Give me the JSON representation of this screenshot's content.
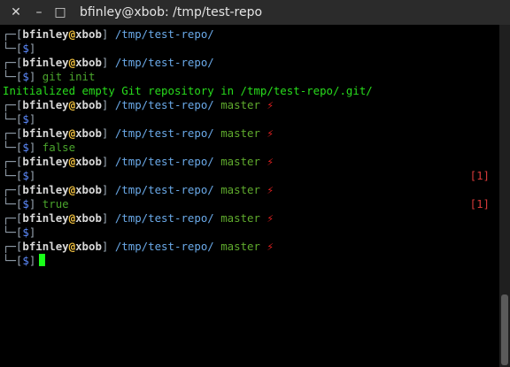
{
  "window": {
    "title": "bfinley@xbob: /tmp/test-repo",
    "close_glyph": "✕",
    "minimize_glyph": "–",
    "maximize_glyph": "□"
  },
  "prompt": {
    "top_frame": "┌─[",
    "user": "bfinley",
    "at": "@",
    "host": "xbob",
    "close_bracket": "]",
    "bottom_frame": "└─[",
    "dollar": "$",
    "bolt": "⚡"
  },
  "terminal": {
    "lines": [
      {
        "kind": "top",
        "path": "/tmp/test-repo/",
        "branch": ""
      },
      {
        "kind": "bottom",
        "cmd": "",
        "exit": ""
      },
      {
        "kind": "top",
        "path": "/tmp/test-repo/",
        "branch": ""
      },
      {
        "kind": "bottom",
        "cmd": "git init",
        "exit": ""
      },
      {
        "kind": "output",
        "text": "Initialized empty Git repository in /tmp/test-repo/.git/"
      },
      {
        "kind": "top",
        "path": "/tmp/test-repo/",
        "branch": "master"
      },
      {
        "kind": "bottom",
        "cmd": "",
        "exit": ""
      },
      {
        "kind": "top",
        "path": "/tmp/test-repo/",
        "branch": "master"
      },
      {
        "kind": "bottom",
        "cmd": "false",
        "exit": ""
      },
      {
        "kind": "top",
        "path": "/tmp/test-repo/",
        "branch": "master"
      },
      {
        "kind": "bottom",
        "cmd": "",
        "exit": "[1]"
      },
      {
        "kind": "top",
        "path": "/tmp/test-repo/",
        "branch": "master"
      },
      {
        "kind": "bottom",
        "cmd": "true",
        "exit": "[1]"
      },
      {
        "kind": "top",
        "path": "/tmp/test-repo/",
        "branch": "master"
      },
      {
        "kind": "bottom",
        "cmd": "",
        "exit": ""
      },
      {
        "kind": "top",
        "path": "/tmp/test-repo/",
        "branch": "master"
      },
      {
        "kind": "cursor"
      }
    ]
  },
  "colors": {
    "user": "#d9d9d9",
    "at": "#f0c040",
    "path": "#6aa9e8",
    "branch": "#5faa2d",
    "bolt": "#e02020",
    "output": "#28dc1c",
    "exit_code": "#d93a3a",
    "cursor": "#1aff1a"
  }
}
